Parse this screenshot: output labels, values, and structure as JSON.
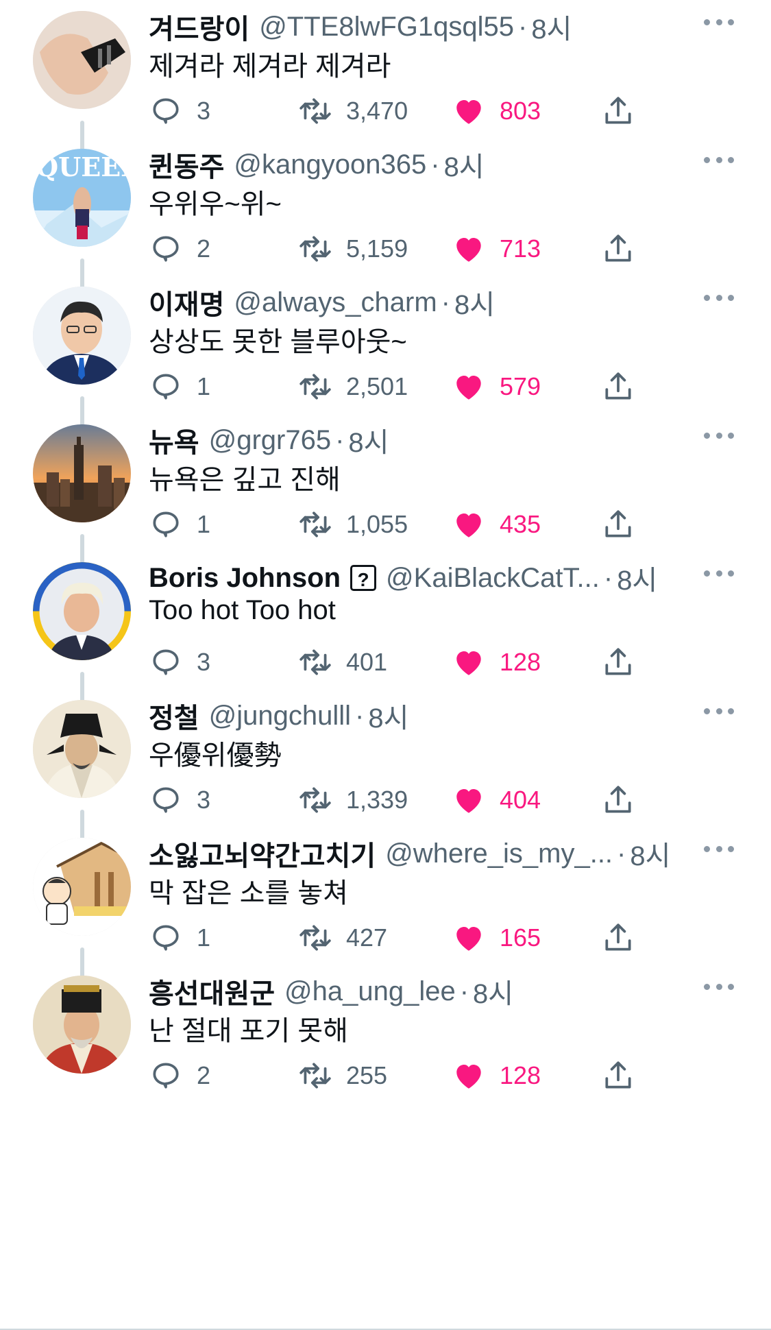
{
  "accent_color": "#f91880",
  "line_color": "#cfd9de",
  "tweets": [
    {
      "name": "겨드랑이",
      "handle": "@TTE8lwFG1qsql55",
      "sep": "·",
      "time": "8시",
      "text": "제겨라 제겨라 제겨라",
      "replies": "3",
      "retweets": "3,470",
      "likes": "803",
      "avatar": "hand-photo"
    },
    {
      "name": "퀸동주",
      "handle": "@kangyoon365",
      "sep": "·",
      "time": "8시",
      "text": "우위우~위~",
      "replies": "2",
      "retweets": "5,159",
      "likes": "713",
      "avatar": "queen-poster"
    },
    {
      "name": "이재명",
      "handle": "@always_charm",
      "sep": "·",
      "time": "8시",
      "text": "상상도 못한 블루아웃~",
      "replies": "1",
      "retweets": "2,501",
      "likes": "579",
      "avatar": "man-in-suit"
    },
    {
      "name": "뉴욕",
      "handle": "@grgr765",
      "sep": "·",
      "time": "8시",
      "text": "뉴욕은 깊고 진해",
      "replies": "1",
      "retweets": "1,055",
      "likes": "435",
      "avatar": "city-skyline"
    },
    {
      "name": "Boris Johnson",
      "badge": "?",
      "handle": "@KaiBlackCatT...",
      "sep": "·",
      "time": "8시",
      "text": "Too hot Too hot",
      "replies": "3",
      "retweets": "401",
      "likes": "128",
      "avatar": "blonde-man"
    },
    {
      "name": "정철",
      "handle": "@jungchulll",
      "sep": "·",
      "time": "8시",
      "text": "우優위優勢",
      "replies": "3",
      "retweets": "1,339",
      "likes": "404",
      "avatar": "scholar-portrait"
    },
    {
      "name": "소잃고뇌약간고치기",
      "handle": "@where_is_my_...",
      "sep": "·",
      "time": "8시",
      "text": "막 잡은 소를 놓쳐",
      "replies": "1",
      "retweets": "427",
      "likes": "165",
      "avatar": "cartoon-barn"
    },
    {
      "name": "흥선대원군",
      "handle": "@ha_ung_lee",
      "sep": "·",
      "time": "8시",
      "text": "난 절대 포기 못해",
      "replies": "2",
      "retweets": "255",
      "likes": "128",
      "avatar": "regent-portrait"
    }
  ],
  "icons": {
    "reply": "reply-icon",
    "retweet": "retweet-icon",
    "like": "heart-icon",
    "share": "share-icon",
    "more": "more-icon"
  }
}
